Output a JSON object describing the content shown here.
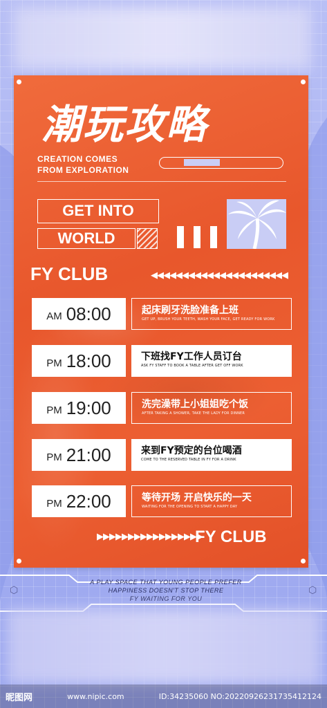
{
  "poster": {
    "title": "潮玩攻略",
    "subtitle_line1": "CREATION COMES",
    "subtitle_line2": "FROM EXPLORATION",
    "label_get_into": "GET INTO",
    "label_world": "WORLD",
    "club_name": "FY CLUB",
    "club_name_bottom": "FY CLUB",
    "progress": 0.4
  },
  "schedule": [
    {
      "period": "AM",
      "time": "08:00",
      "title": "起床刷牙洗脸准备上班",
      "subtitle": "GET UP, BRUSH YOUR TEETH, WASH YOUR FACE, GET READY FOR WORK",
      "style": "outline"
    },
    {
      "period": "PM",
      "time": "18:00",
      "title": "下班找FY工作人员订台",
      "subtitle": "ASK FY STAFF TO BOOK A TABLE AFTER GET OFF WORK",
      "style": "solid"
    },
    {
      "period": "PM",
      "time": "19:00",
      "title": "洗完澡带上小姐姐吃个饭",
      "subtitle": "AFTER TAKING A SHOWER, TAKE THE LADY FOR DINNER",
      "style": "outline"
    },
    {
      "period": "PM",
      "time": "21:00",
      "title": "来到FY预定的台位喝酒",
      "subtitle": "COME TO THE RESERVED TABLE IN FY FOR A DRINK",
      "style": "solid"
    },
    {
      "period": "PM",
      "time": "22:00",
      "title": "等待开场 开启快乐的一天",
      "subtitle": "WAITING FOR THE OPENING TO START A HAPPY DAY",
      "style": "outline"
    }
  ],
  "tagline": {
    "line1": "A PLAY SPACE THAT YOUNG PEOPLE PREFER",
    "line2": "HAPPINESS DOESN'T STOP THERE",
    "line3": "FY WAITING FOR YOU"
  },
  "footer": {
    "logo": "昵图网",
    "url": "www.nipic.com",
    "id_text": "ID:34235060 NO:20220926231735412124"
  },
  "colors": {
    "poster": "#e8572c",
    "background": "#a9b3f2",
    "accent": "#c9cdf5"
  }
}
